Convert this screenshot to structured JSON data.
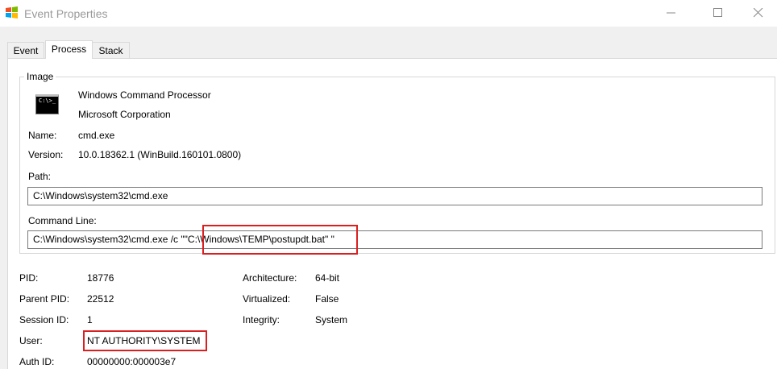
{
  "window": {
    "title": "Event Properties"
  },
  "tabs": [
    {
      "label": "Event",
      "active": false
    },
    {
      "label": "Process",
      "active": true
    },
    {
      "label": "Stack",
      "active": false
    }
  ],
  "image": {
    "group_label": "Image",
    "description": "Windows Command Processor",
    "company": "Microsoft Corporation",
    "name_label": "Name:",
    "name": "cmd.exe",
    "version_label": "Version:",
    "version": "10.0.18362.1 (WinBuild.160101.0800)",
    "path_label": "Path:",
    "path": "C:\\Windows\\system32\\cmd.exe",
    "cmdline_label": "Command Line:",
    "cmdline": "C:\\Windows\\system32\\cmd.exe /c \"\"C:\\Windows\\TEMP\\postupdt.bat\" \"",
    "icon": "cmd-icon"
  },
  "details": {
    "pid_label": "PID:",
    "pid": "18776",
    "ppid_label": "Parent PID:",
    "ppid": "22512",
    "session_label": "Session ID:",
    "session": "1",
    "user_label": "User:",
    "user": "NT AUTHORITY\\SYSTEM",
    "auth_label": "Auth ID:",
    "auth": "00000000:000003e7",
    "arch_label": "Architecture:",
    "arch": "64-bit",
    "virt_label": "Virtualized:",
    "virt": "False",
    "integrity_label": "Integrity:",
    "integrity": "System"
  },
  "colors": {
    "highlight": "#d91f1f",
    "title_text": "#9a9a9a"
  }
}
